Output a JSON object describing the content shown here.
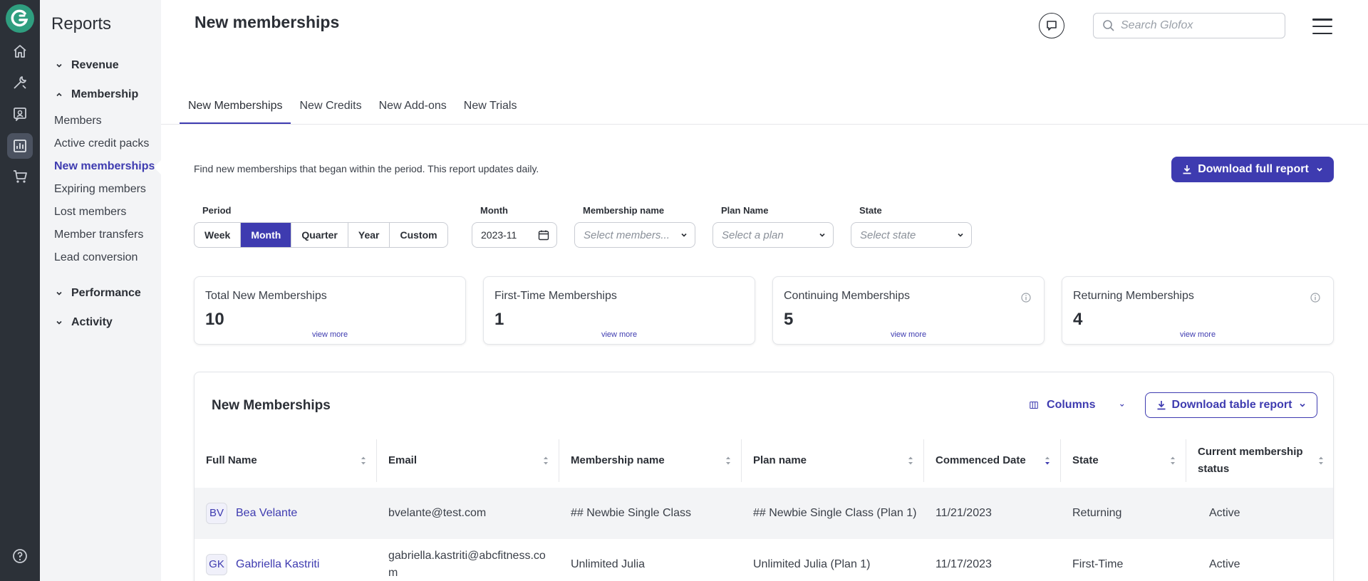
{
  "sidebar": {
    "title": "Reports",
    "sections": {
      "revenue": "Revenue",
      "membership": "Membership",
      "performance": "Performance",
      "activity": "Activity"
    },
    "items": [
      "Members",
      "Active credit packs",
      "New memberships",
      "Expiring members",
      "Lost members",
      "Member transfers",
      "Lead conversion"
    ],
    "active_item": "New memberships"
  },
  "header": {
    "title": "New memberships",
    "search_placeholder": "Search Glofox"
  },
  "tabs": [
    "New Memberships",
    "New Credits",
    "New Add-ons",
    "New Trials"
  ],
  "description": "Find new memberships that began within the period. This report updates daily.",
  "download_full": "Download full report",
  "filters": {
    "period_label": "Period",
    "periods": [
      "Week",
      "Month",
      "Quarter",
      "Year",
      "Custom"
    ],
    "active_period": "Month",
    "month_label": "Month",
    "month_value": "2023-11",
    "membership_label": "Membership name",
    "membership_placeholder": "Select members...",
    "plan_label": "Plan Name",
    "plan_placeholder": "Select a plan",
    "state_label": "State",
    "state_placeholder": "Select state"
  },
  "cards": [
    {
      "title": "Total New Memberships",
      "value": "10",
      "more": "view more"
    },
    {
      "title": "First-Time Memberships",
      "value": "1",
      "more": "view more"
    },
    {
      "title": "Continuing Memberships",
      "value": "5",
      "more": "view more"
    },
    {
      "title": "Returning Memberships",
      "value": "4",
      "more": "view more"
    }
  ],
  "table": {
    "title": "New Memberships",
    "columns_btn": "Columns",
    "download_btn": "Download table report",
    "headers": [
      "Full Name",
      "Email",
      "Membership name",
      "Plan name",
      "Commenced Date",
      "State",
      "Current membership status"
    ],
    "rows": [
      {
        "initials": "BV",
        "name": "Bea Velante",
        "email": "bvelante@test.com",
        "membership": "## Newbie Single Class",
        "plan": "## Newbie Single Class (Plan 1)",
        "date": "11/21/2023",
        "state": "Returning",
        "status": "Active"
      },
      {
        "initials": "GK",
        "name": "Gabriella Kastriti",
        "email": "gabriella.kastriti@abcfitness.com",
        "membership": "Unlimited Julia",
        "plan": "Unlimited Julia (Plan 1)",
        "date": "11/17/2023",
        "state": "First-Time",
        "status": "Active"
      }
    ]
  },
  "colors": {
    "accent": "#3e3bb0",
    "rail": "#2c3138",
    "sidebar": "#f3f4f6",
    "logo": "#2f9e7f"
  }
}
